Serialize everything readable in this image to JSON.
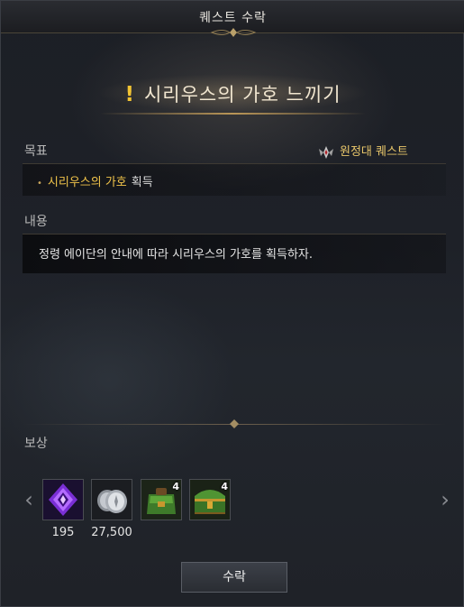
{
  "window": {
    "title": "퀘스트 수락"
  },
  "quest": {
    "title": "시리우스의 가호 느끼기",
    "type_label": "원정대 퀘스트"
  },
  "sections": {
    "goal": "목표",
    "content": "내용",
    "reward": "보상"
  },
  "goal": {
    "highlight": "시리우스의 가호",
    "action": "획득"
  },
  "content": {
    "text": "정령 에이단의 안내에 따라 시리우스의 가호를 획득하자."
  },
  "rewards": [
    {
      "icon": "purple-crystal-icon",
      "quantity": "195"
    },
    {
      "icon": "silver-coins-icon",
      "quantity": "27,500"
    },
    {
      "icon": "green-bag-icon",
      "count": "4"
    },
    {
      "icon": "green-chest-icon",
      "count": "4"
    }
  ],
  "nav": {
    "prev": "‹",
    "next": "›"
  },
  "buttons": {
    "accept": "수락"
  },
  "colors": {
    "accent_gold": "#f0c34a",
    "exclaim_yellow": "#f2c433",
    "title_text": "#f1e6d0"
  }
}
